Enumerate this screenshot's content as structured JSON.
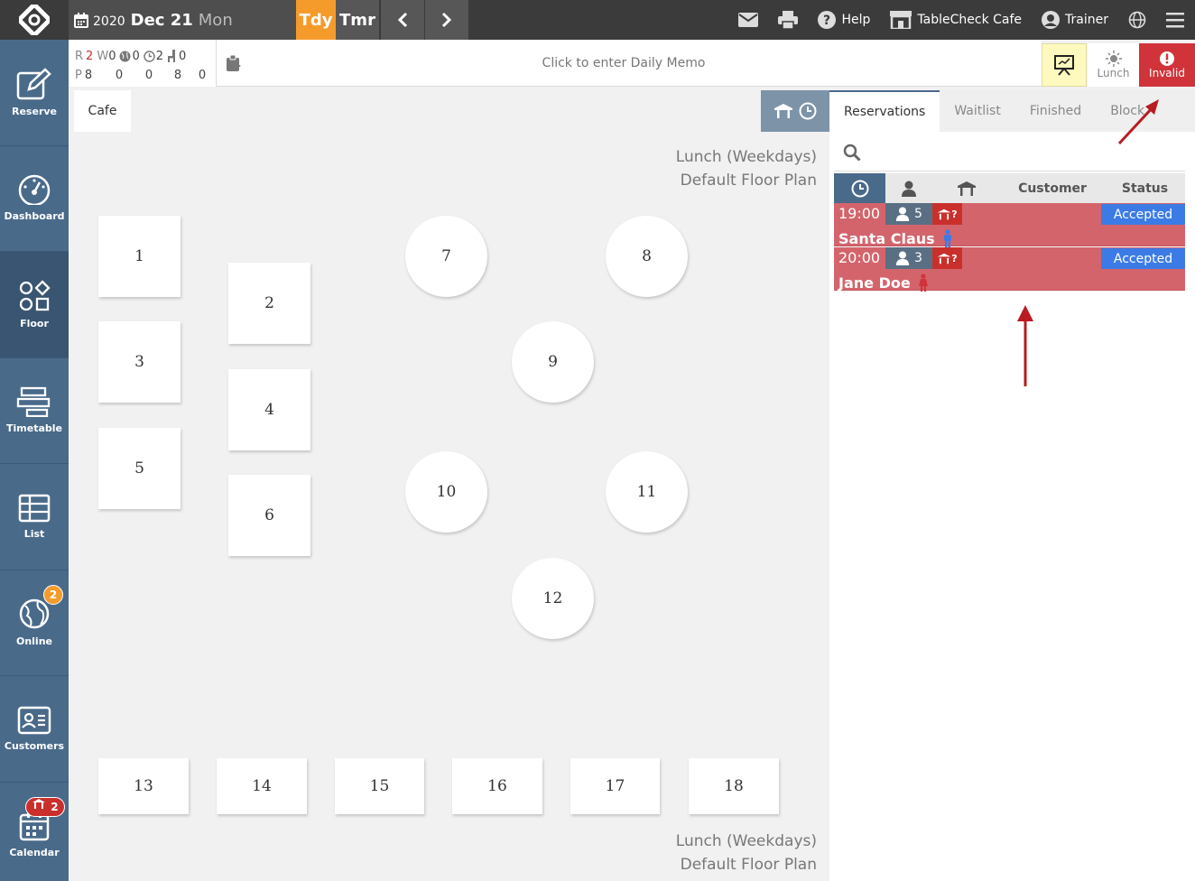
{
  "header": {
    "year": "2020",
    "month_day": "Dec 21",
    "weekday": "Mon",
    "today_label": "Tdy",
    "tomorrow_label": "Tmr",
    "help_label": "Help",
    "store_label": "TableCheck Cafe",
    "user_label": "Trainer"
  },
  "sidebar": {
    "items": [
      {
        "label": "Reserve",
        "icon": "edit-icon"
      },
      {
        "label": "Dashboard",
        "icon": "gauge-icon"
      },
      {
        "label": "Floor",
        "icon": "shapes-icon"
      },
      {
        "label": "Timetable",
        "icon": "timetable-icon"
      },
      {
        "label": "List",
        "icon": "table-list-icon"
      },
      {
        "label": "Online",
        "icon": "globe-icon",
        "badge": "2"
      },
      {
        "label": "Customers",
        "icon": "id-card-icon"
      },
      {
        "label": "Calendar",
        "icon": "calendar-icon",
        "badge": "2"
      }
    ]
  },
  "stats": {
    "r_label": "R",
    "r_value": "2",
    "w_label": "W",
    "w_value": "0",
    "globe_value": "0",
    "clock_value": "2",
    "chair_value": "0",
    "p_label": "P",
    "p_values": [
      "8",
      "0",
      "0",
      "8",
      "0"
    ]
  },
  "memo": {
    "placeholder": "Click to enter Daily Memo"
  },
  "shift": {
    "lunch_label": "Lunch",
    "invalid_label": "Invalid"
  },
  "floor": {
    "tab_label": "Cafe",
    "plan_line1": "Lunch (Weekdays)",
    "plan_line2": "Default Floor Plan",
    "tables": [
      "1",
      "2",
      "3",
      "4",
      "5",
      "6",
      "7",
      "8",
      "9",
      "10",
      "11",
      "12",
      "13",
      "14",
      "15",
      "16",
      "17",
      "18"
    ]
  },
  "panel": {
    "tabs": [
      "Reservations",
      "Waitlist",
      "Finished",
      "Block"
    ],
    "columns": {
      "customer": "Customer",
      "status": "Status"
    },
    "reservations": [
      {
        "time": "19:00",
        "party": "5",
        "table": "?",
        "status": "Accepted",
        "name": "Santa Claus",
        "gender": "male"
      },
      {
        "time": "20:00",
        "party": "3",
        "table": "?",
        "status": "Accepted",
        "name": "Jane Doe",
        "gender": "female"
      }
    ]
  },
  "colors": {
    "topbar": "#3b3b3b",
    "accent_orange": "#f59b2b",
    "sidebar": "#4a6a8a",
    "invalid_red": "#d0343a",
    "reservation_row": "#d4646c",
    "status_blue": "#3c7be6",
    "arrow_red": "#b81c22"
  }
}
